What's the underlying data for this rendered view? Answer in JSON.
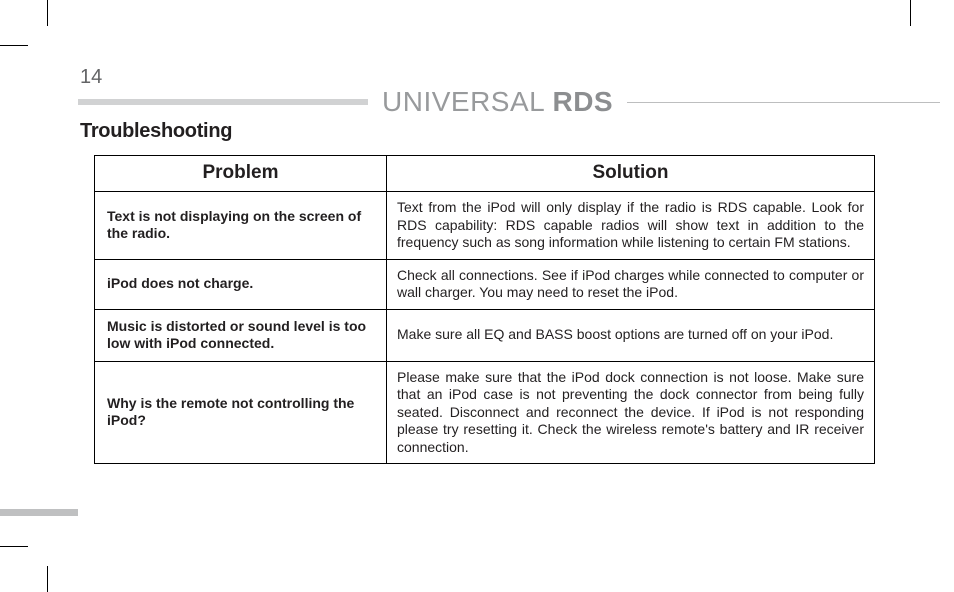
{
  "page_number": "14",
  "doc_title_light": "UNIVERSAL ",
  "doc_title_bold": "RDS",
  "section_title": "Troubleshooting",
  "table": {
    "headers": {
      "problem": "Problem",
      "solution": "Solution"
    },
    "rows": [
      {
        "problem": "Text is not displaying on the screen of the radio.",
        "solution": "Text from the iPod will only display if the radio is RDS capable. Look for RDS capability: RDS capable radios will show text in addition to the frequency such as song information while listening to certain FM stations."
      },
      {
        "problem": "iPod does not charge.",
        "solution": "Check all connections. See if iPod charges while connected to computer or wall charger. You may need to reset the iPod."
      },
      {
        "problem": "Music is distorted or sound level is too low with iPod connected.",
        "solution": "Make sure all EQ and BASS boost options are turned off on your iPod."
      },
      {
        "problem": "Why is the remote not controlling the iPod?",
        "solution": "Please make sure that the iPod dock connection is not loose. Make sure that an iPod case is not preventing the dock connector from being fully seated. Disconnect and reconnect the device. If iPod is not responding please try resetting it. Check the wireless remote's battery and IR receiver connection."
      }
    ]
  }
}
